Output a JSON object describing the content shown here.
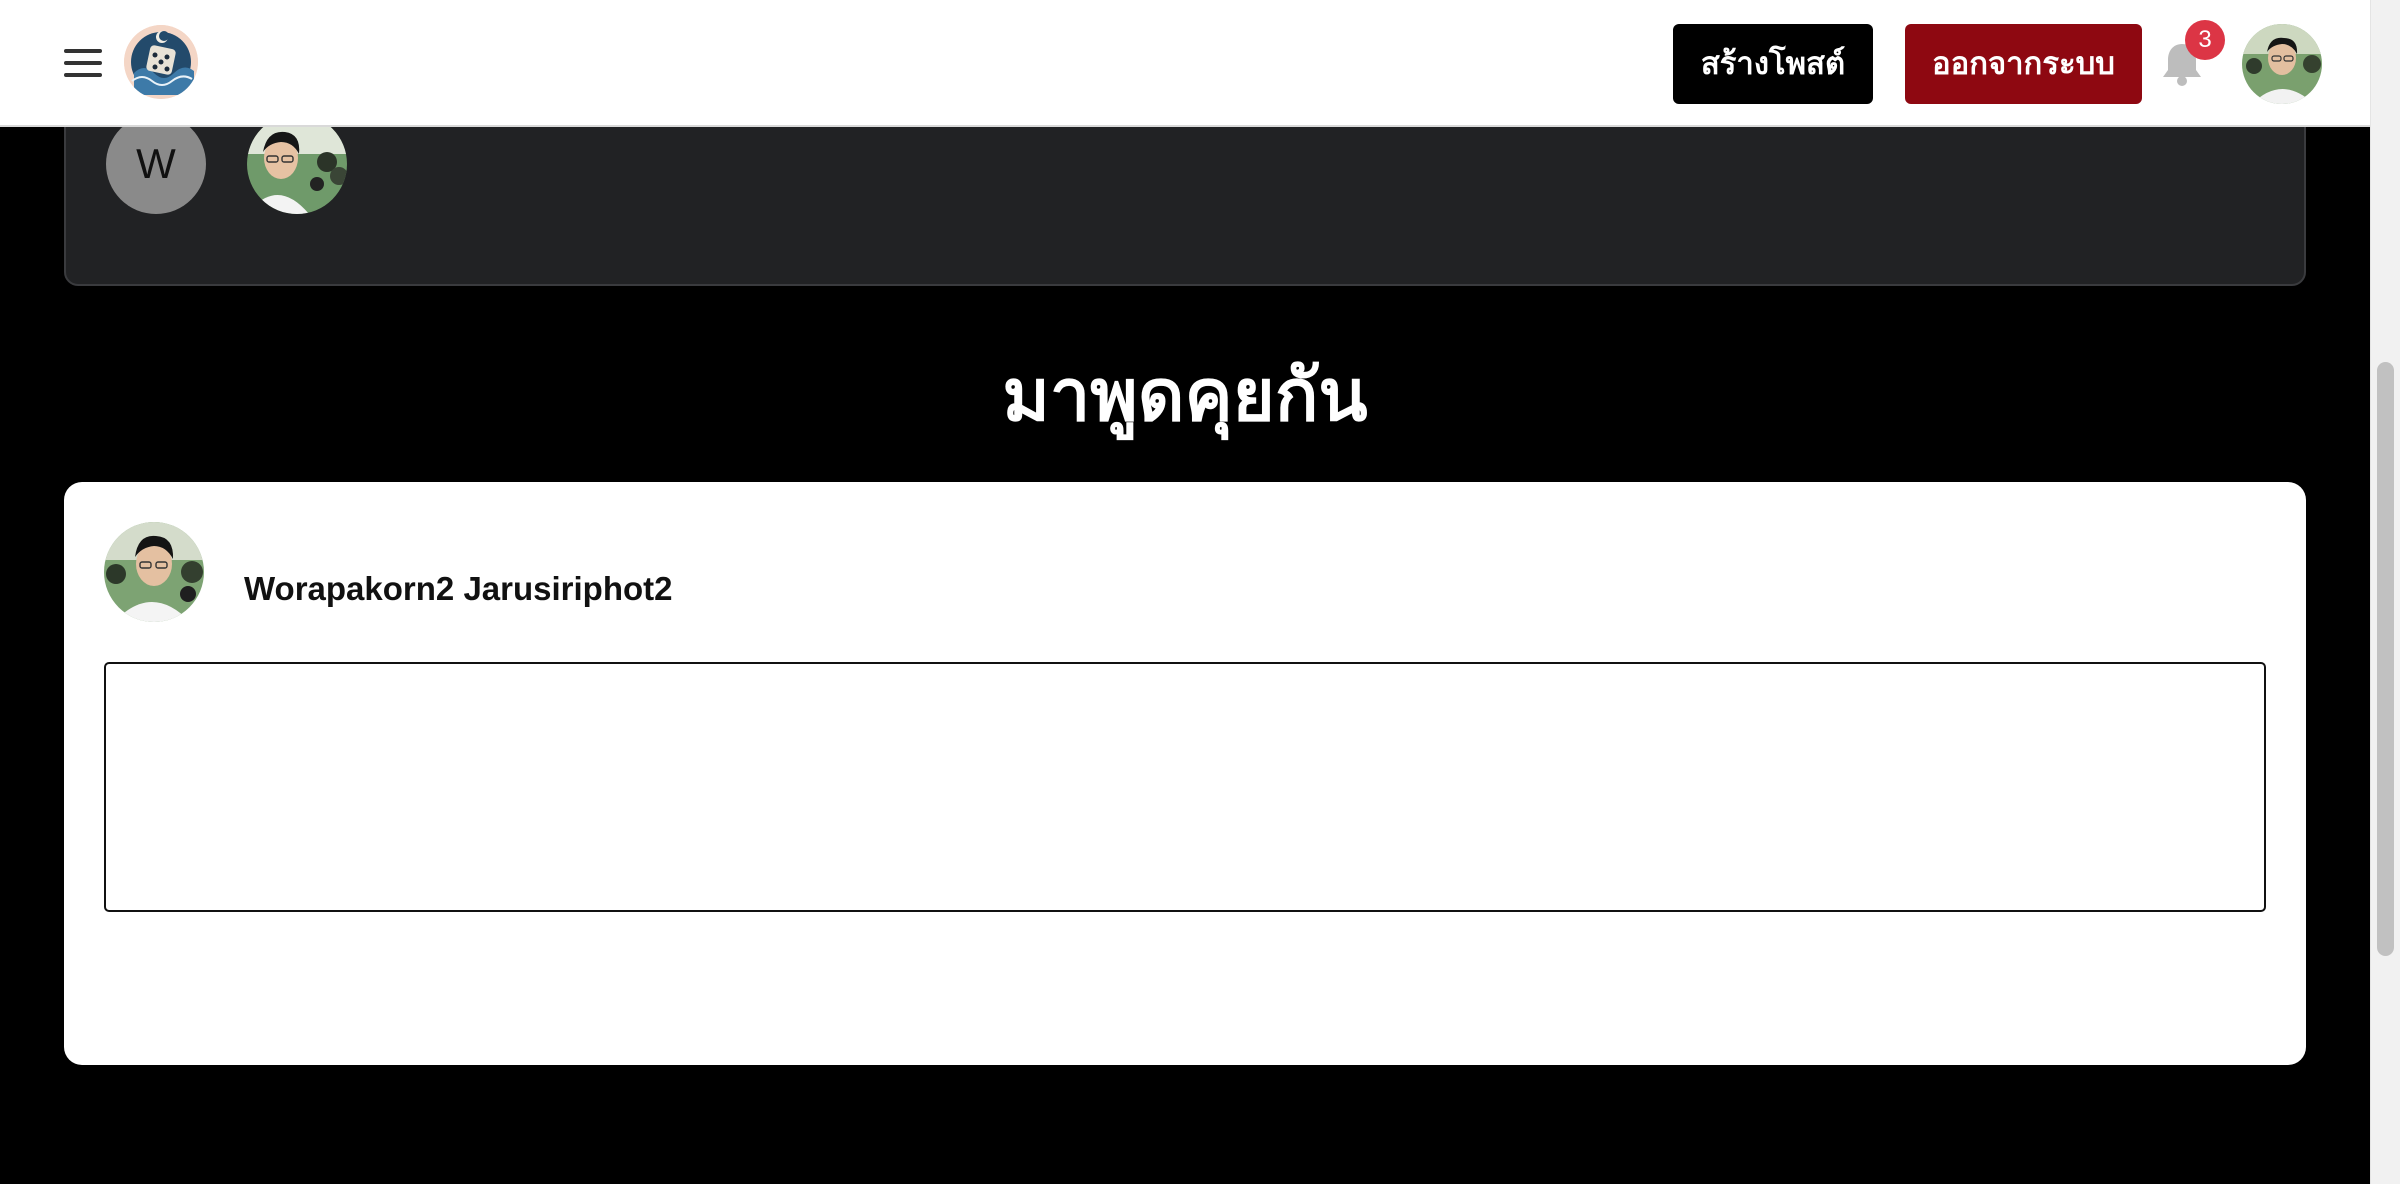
{
  "navbar": {
    "create_post_label": "สร้างโพสต์",
    "logout_label": "ออกจากระบบ",
    "notification_count": "3",
    "menu_icon": "hamburger-menu-icon",
    "notification_icon": "bell-icon"
  },
  "participants": {
    "items": [
      {
        "type": "initial",
        "initial": "W"
      },
      {
        "type": "photo"
      }
    ]
  },
  "discussion": {
    "title": "มาพูดคุยกัน"
  },
  "composer": {
    "author_name": "Worapakorn2 Jarusiriphot2",
    "input_value": "",
    "input_placeholder": ""
  },
  "colors": {
    "page_background": "#000000",
    "navbar_background": "#ffffff",
    "create_button": "#000000",
    "logout_button": "#8e0811",
    "badge": "#dc3545",
    "participants_card": "#212224",
    "composer_card": "#ffffff"
  }
}
